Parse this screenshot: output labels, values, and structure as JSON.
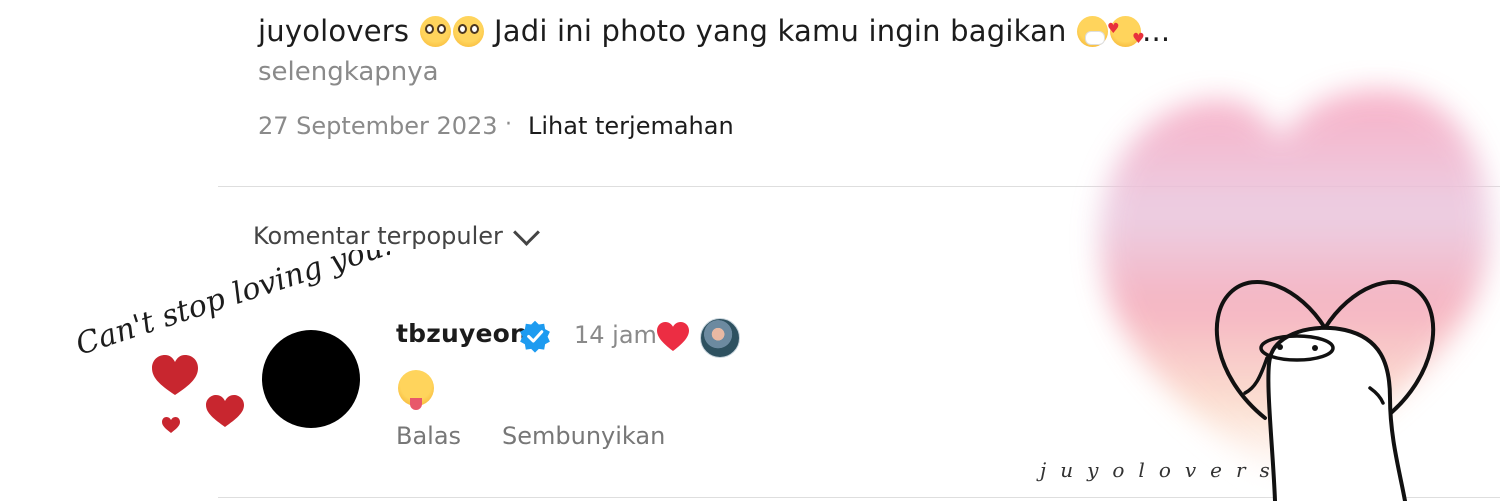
{
  "post": {
    "caption_user": "juyolovers",
    "caption_text": "Jadi ini photo yang kamu ingin bagikan",
    "caption_emojis": [
      "flushed-face",
      "flushed-face",
      "sneezing-face",
      "smiling-face-with-hearts"
    ],
    "caption_ellipsis": "...",
    "more_label": "selengkapnya",
    "date": "27 September 2023",
    "separator": "·",
    "translate_label": "Lihat terjemahan"
  },
  "comments_header": {
    "sort_label": "Komentar terpopuler",
    "sort_icon": "chevron-down-icon"
  },
  "comment": {
    "username": "tbzuyeon",
    "verified": true,
    "time": "14 jam",
    "liked_by_author": true,
    "body_emoji": "squinting-face-with-tongue",
    "reply_label": "Balas",
    "hide_label": "Sembunyikan"
  },
  "decor": {
    "handwritten_text": "Can't stop loving you!",
    "watermark_text": "juyolovers"
  },
  "colors": {
    "verified_blue": "#1d9bf0",
    "like_red": "#ec2d43",
    "muted_text": "#8a8a8a",
    "divider": "#dedede"
  }
}
